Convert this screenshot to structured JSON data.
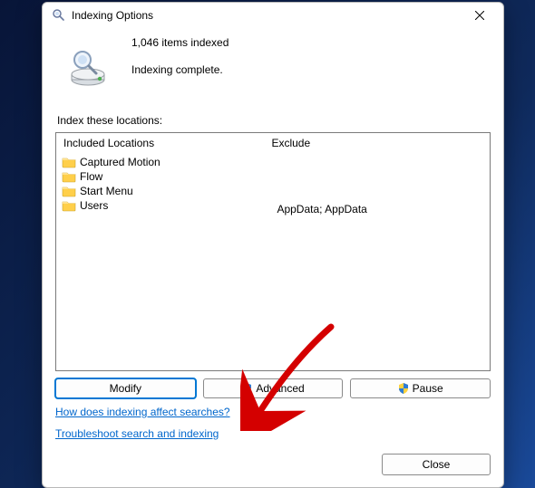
{
  "window": {
    "title": "Indexing Options"
  },
  "status": {
    "count_text": "1,046 items indexed",
    "state_text": "Indexing complete."
  },
  "locations": {
    "label": "Index these locations:",
    "headers": {
      "included": "Included Locations",
      "exclude": "Exclude"
    },
    "items": [
      {
        "name": "Captured Motion",
        "exclude": ""
      },
      {
        "name": "Flow",
        "exclude": ""
      },
      {
        "name": "Start Menu",
        "exclude": ""
      },
      {
        "name": "Users",
        "exclude": "AppData; AppData"
      }
    ]
  },
  "buttons": {
    "modify": "Modify",
    "advanced": "Advanced",
    "pause": "Pause",
    "close": "Close"
  },
  "links": {
    "help": "How does indexing affect searches?",
    "troubleshoot": "Troubleshoot search and indexing"
  }
}
